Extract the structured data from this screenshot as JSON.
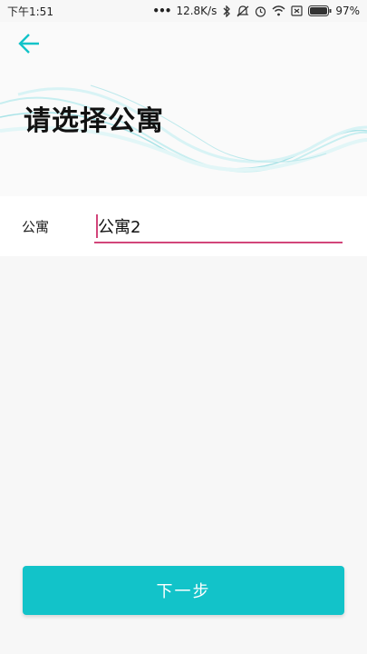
{
  "status_bar": {
    "time": "下午1:51",
    "dots": "•••",
    "network_speed": "12.8K/s",
    "battery_percent": "97%",
    "icons": [
      "bluetooth-icon",
      "mute-icon",
      "alarm-icon",
      "wifi-icon",
      "no-sim-icon",
      "battery-icon"
    ]
  },
  "header": {
    "back_icon": "arrow-left-icon",
    "title": "请选择公寓",
    "accent_color": "#12c3c9"
  },
  "form": {
    "apartment_label": "公寓",
    "apartment_value": "公寓2",
    "underline_color": "#d2457a"
  },
  "footer": {
    "next_label": "下一步",
    "button_color": "#12c3c9"
  }
}
